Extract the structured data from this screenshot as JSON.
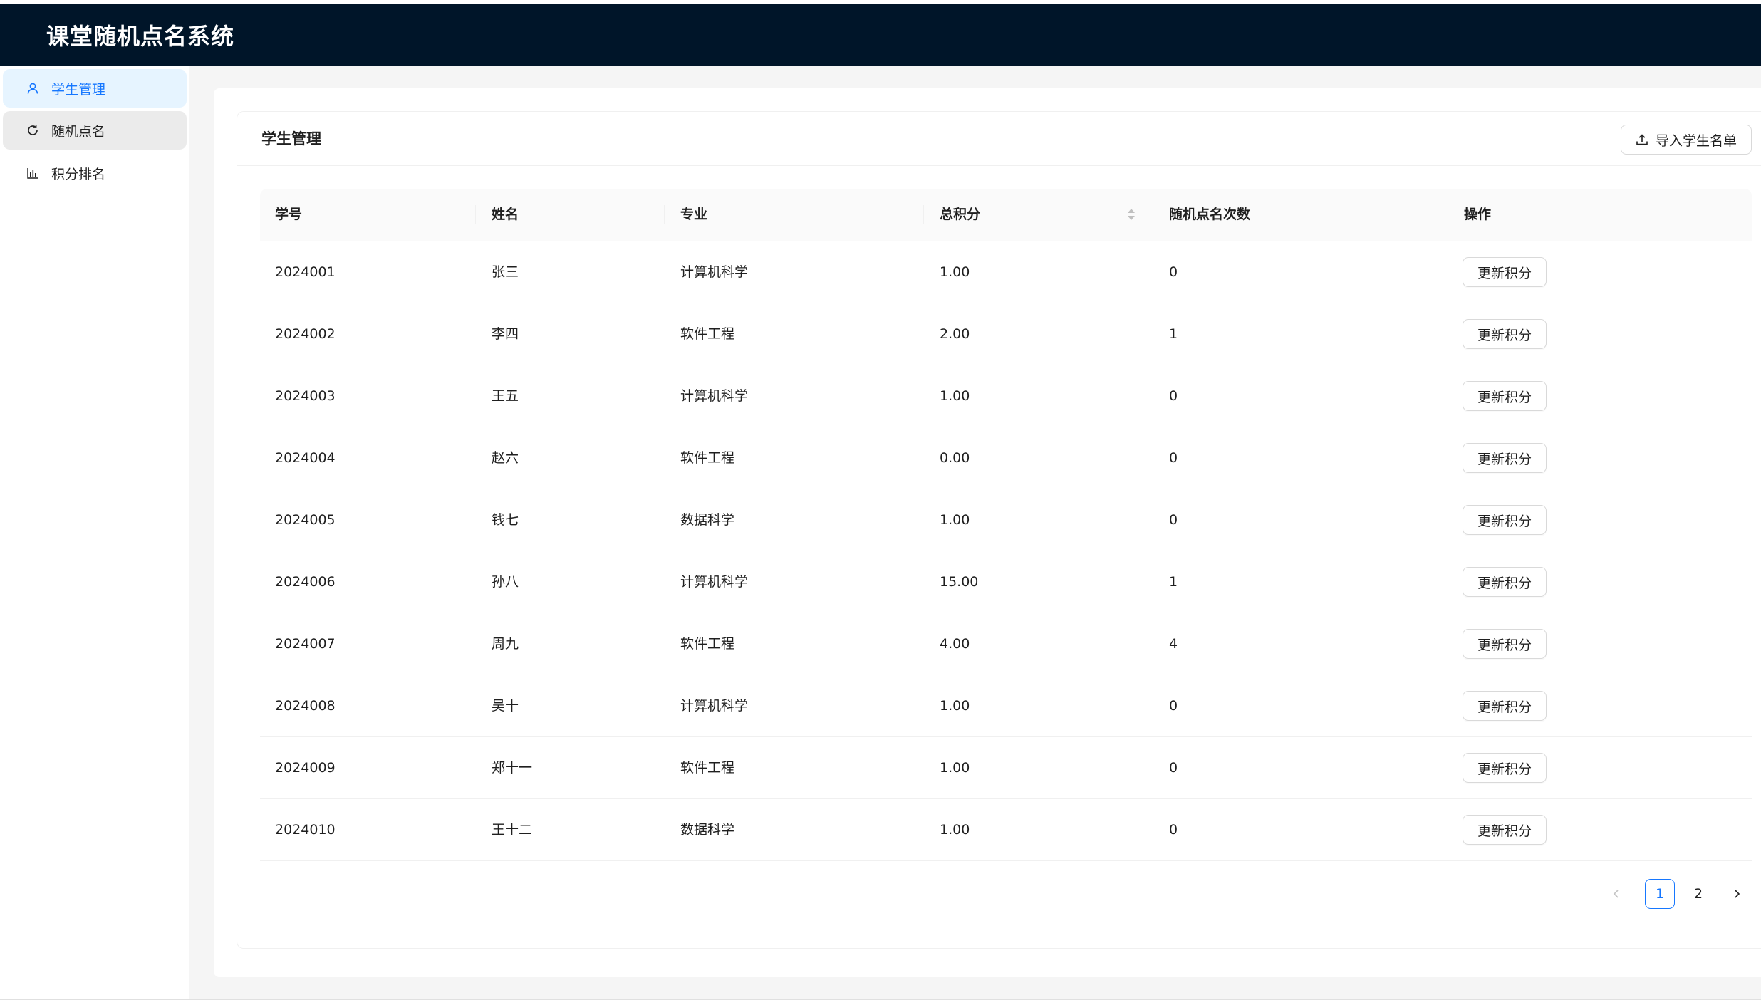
{
  "app": {
    "title": "课堂随机点名系统"
  },
  "sidebar": {
    "items": [
      {
        "label": "学生管理",
        "icon": "user-icon",
        "state": "selected"
      },
      {
        "label": "随机点名",
        "icon": "reload-icon",
        "state": "hovered"
      },
      {
        "label": "积分排名",
        "icon": "bar-chart-icon",
        "state": "normal"
      }
    ]
  },
  "card": {
    "title": "学生管理",
    "import_label": "导入学生名单"
  },
  "table": {
    "columns": [
      "学号",
      "姓名",
      "专业",
      "总积分",
      "随机点名次数",
      "操作"
    ],
    "rows": [
      {
        "id": "2024001",
        "name": "张三",
        "major": "计算机科学",
        "score": "1.00",
        "count": "0",
        "action": "更新积分"
      },
      {
        "id": "2024002",
        "name": "李四",
        "major": "软件工程",
        "score": "2.00",
        "count": "1",
        "action": "更新积分"
      },
      {
        "id": "2024003",
        "name": "王五",
        "major": "计算机科学",
        "score": "1.00",
        "count": "0",
        "action": "更新积分"
      },
      {
        "id": "2024004",
        "name": "赵六",
        "major": "软件工程",
        "score": "0.00",
        "count": "0",
        "action": "更新积分"
      },
      {
        "id": "2024005",
        "name": "钱七",
        "major": "数据科学",
        "score": "1.00",
        "count": "0",
        "action": "更新积分"
      },
      {
        "id": "2024006",
        "name": "孙八",
        "major": "计算机科学",
        "score": "15.00",
        "count": "1",
        "action": "更新积分"
      },
      {
        "id": "2024007",
        "name": "周九",
        "major": "软件工程",
        "score": "4.00",
        "count": "4",
        "action": "更新积分"
      },
      {
        "id": "2024008",
        "name": "吴十",
        "major": "计算机科学",
        "score": "1.00",
        "count": "0",
        "action": "更新积分"
      },
      {
        "id": "2024009",
        "name": "郑十一",
        "major": "软件工程",
        "score": "1.00",
        "count": "0",
        "action": "更新积分"
      },
      {
        "id": "2024010",
        "name": "王十二",
        "major": "数据科学",
        "score": "1.00",
        "count": "0",
        "action": "更新积分"
      }
    ]
  },
  "pagination": {
    "pages": [
      "1",
      "2"
    ],
    "current": "1"
  },
  "colors": {
    "header_bg": "#001529",
    "accent": "#1677ff",
    "selected_bg": "#e6f4ff",
    "layout_bg": "#f5f5f5"
  }
}
